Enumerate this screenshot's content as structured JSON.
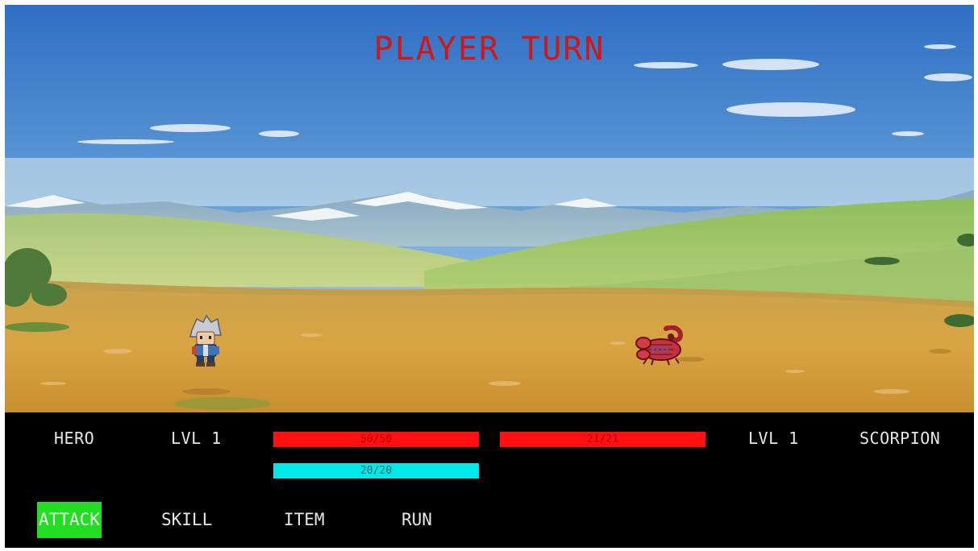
{
  "battle": {
    "turn_banner": "PLAYER TURN"
  },
  "hero": {
    "name": "HERO",
    "level": "LVL 1",
    "hp": {
      "current": 50,
      "max": 50,
      "text": "50/50",
      "fraction": 1.0
    },
    "mp": {
      "current": 20,
      "max": 20,
      "text": "20/20",
      "fraction": 1.0
    }
  },
  "enemy": {
    "name": "SCORPION",
    "level": "LVL 1",
    "hp": {
      "current": 21,
      "max": 21,
      "text": "21/21",
      "fraction": 1.0
    }
  },
  "commands": [
    {
      "label": "ATTACK",
      "selected": true
    },
    {
      "label": "SKILL",
      "selected": false
    },
    {
      "label": "ITEM",
      "selected": false
    },
    {
      "label": "RUN",
      "selected": false
    }
  ],
  "colors": {
    "banner": "#d01818",
    "hp_bar": "#ff1010",
    "mp_bar": "#00e8e8",
    "selected_command": "#22dd22"
  },
  "icons": {
    "hero_sprite": "hero-sprite",
    "enemy_sprite": "scorpion-sprite"
  }
}
